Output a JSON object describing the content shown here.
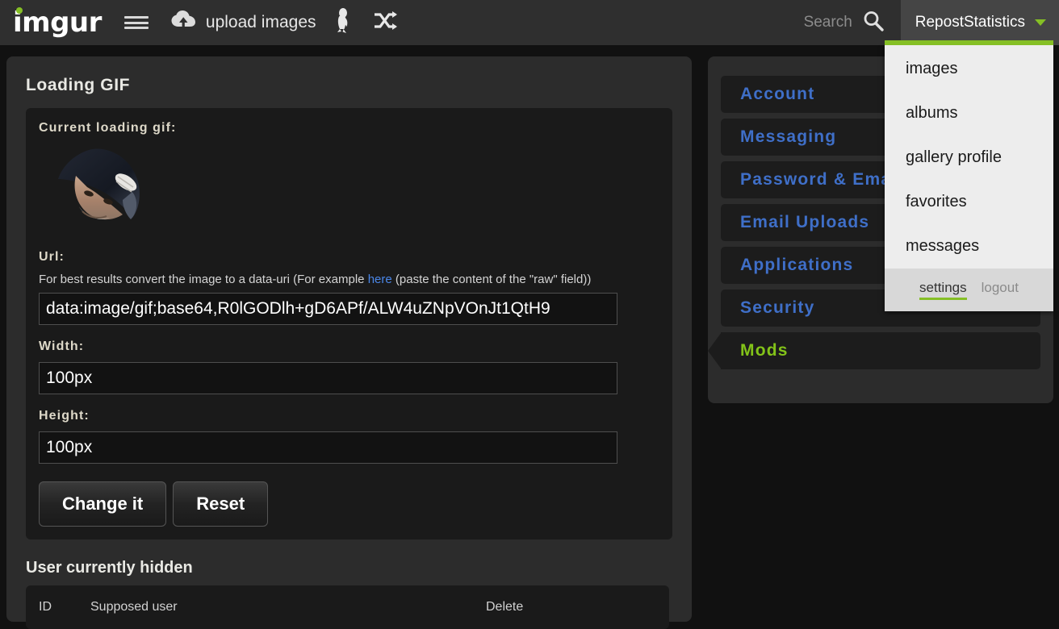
{
  "header": {
    "logo_text": "imgur",
    "menu_icon": "hamburger-menu-icon",
    "upload_label": "upload images",
    "upload_icon": "cloud-upload-icon",
    "penguin_icon": "penguin-icon",
    "shuffle_icon": "shuffle-icon",
    "search_label": "Search",
    "search_icon": "magnifier-icon",
    "username": "RepostStatistics",
    "caret_icon": "chevron-down-icon",
    "accent_green": "#85bf25",
    "header_bg": "#2f2f2f",
    "user_btn_bg": "#454545"
  },
  "user_dropdown": {
    "items": [
      {
        "label": "images"
      },
      {
        "label": "albums"
      },
      {
        "label": "gallery profile"
      },
      {
        "label": "favorites"
      },
      {
        "label": "messages"
      }
    ],
    "footer": {
      "settings_label": "settings",
      "logout_label": "logout"
    },
    "bg": "#ededed",
    "footer_bg": "#d8d8d8"
  },
  "loading_gif_panel": {
    "title": "Loading GIF",
    "current_label": "Current loading gif:",
    "preview_alt": "man-in-bicorne-hat-gif",
    "url_label": "Url:",
    "help_prefix": "For best results convert the image to a data-uri (For example ",
    "help_link": "here",
    "help_suffix": " (paste the content of the \"raw\" field))",
    "url_value": "data:image/gif;base64,R0lGODlh+gD6APf/ALW4uZNpVOnJt1QtH9",
    "width_label": "Width:",
    "width_value": "100px",
    "height_label": "Height:",
    "height_value": "100px",
    "change_button": "Change it",
    "reset_button": "Reset"
  },
  "hidden_users": {
    "title": "User currently hidden",
    "columns": [
      "ID",
      "Supposed user",
      "Delete"
    ],
    "rows": []
  },
  "settings_sidebar": {
    "items": [
      {
        "label": "Account",
        "active": false
      },
      {
        "label": "Messaging",
        "active": false
      },
      {
        "label": "Password & Email",
        "active": false
      },
      {
        "label": "Email Uploads",
        "active": false
      },
      {
        "label": "Applications",
        "active": false
      },
      {
        "label": "Security",
        "active": false
      },
      {
        "label": "Mods",
        "active": true
      }
    ],
    "link_color": "#3f6fc8",
    "active_color": "#83c319"
  }
}
